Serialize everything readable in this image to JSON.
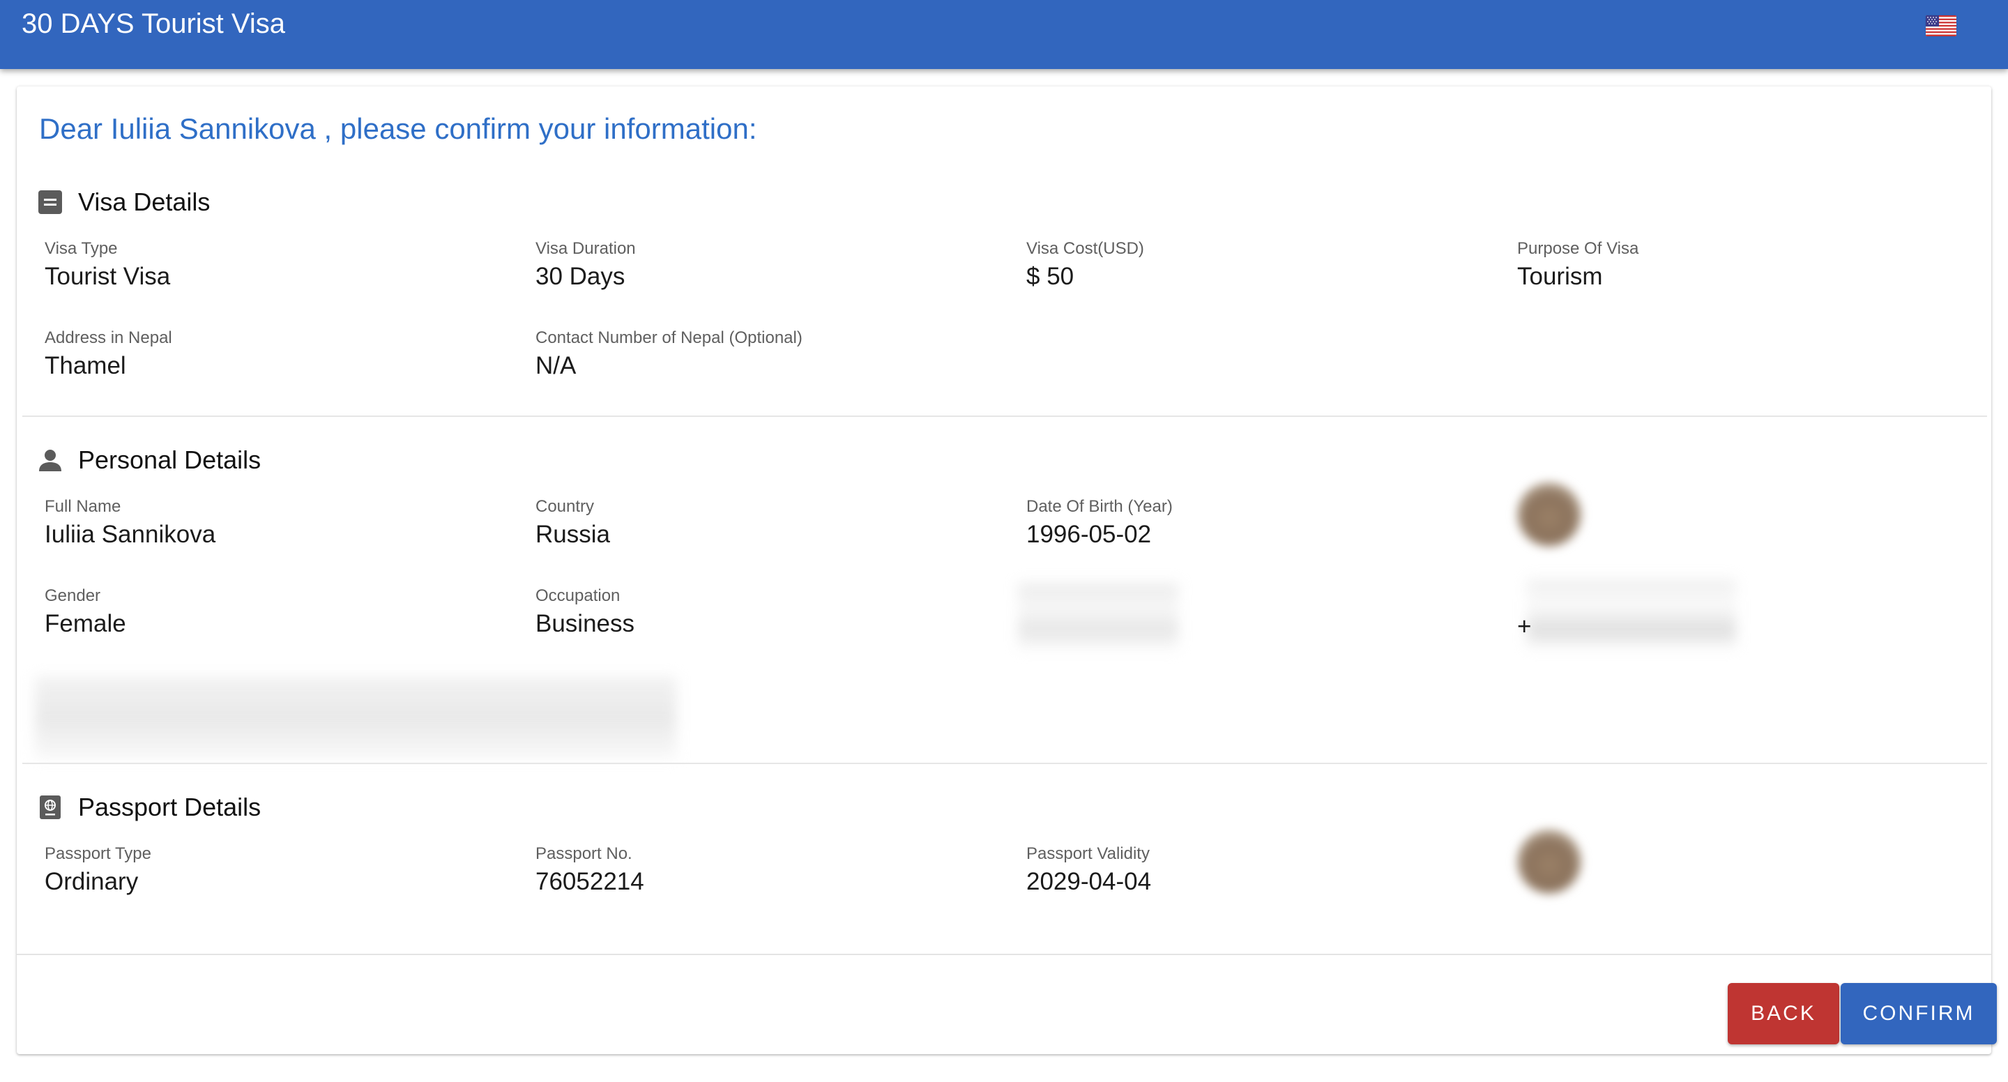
{
  "header": {
    "title": "30 DAYS Tourist Visa",
    "language_icon": "us-flag-icon"
  },
  "greeting": "Dear Iuliia Sannikova , please confirm your information:",
  "visa_details": {
    "title": "Visa Details",
    "icon": "document-list-icon",
    "fields": [
      {
        "label": "Visa Type",
        "value": "Tourist Visa"
      },
      {
        "label": "Visa Duration",
        "value": "30 Days"
      },
      {
        "label": "Visa Cost(USD)",
        "value": "$ 50"
      },
      {
        "label": "Purpose Of Visa",
        "value": "Tourism"
      },
      {
        "label": "Address in Nepal",
        "value": "Thamel"
      },
      {
        "label": "Contact Number of Nepal (Optional)",
        "value": "N/A"
      }
    ]
  },
  "personal_details": {
    "title": "Personal Details",
    "icon": "person-icon",
    "fields": [
      {
        "label": "Full Name",
        "value": "Iuliia Sannikova"
      },
      {
        "label": "Country",
        "value": "Russia"
      },
      {
        "label": "Date Of Birth (Year)",
        "value": "1996-05-02"
      },
      {
        "label": "Gender",
        "value": "Female"
      },
      {
        "label": "Occupation",
        "value": "Business"
      }
    ],
    "phone_prefix": "+"
  },
  "passport_details": {
    "title": "Passport Details",
    "icon": "passport-icon",
    "fields": [
      {
        "label": "Passport Type",
        "value": "Ordinary"
      },
      {
        "label": "Passport No.",
        "value": "76052214"
      },
      {
        "label": "Passport Validity",
        "value": "2029-04-04"
      }
    ]
  },
  "actions": {
    "back_label": "BACK",
    "confirm_label": "CONFIRM"
  },
  "colors": {
    "primary": "#3266be",
    "danger": "#bf3532",
    "greeting": "#2f6fc7"
  }
}
